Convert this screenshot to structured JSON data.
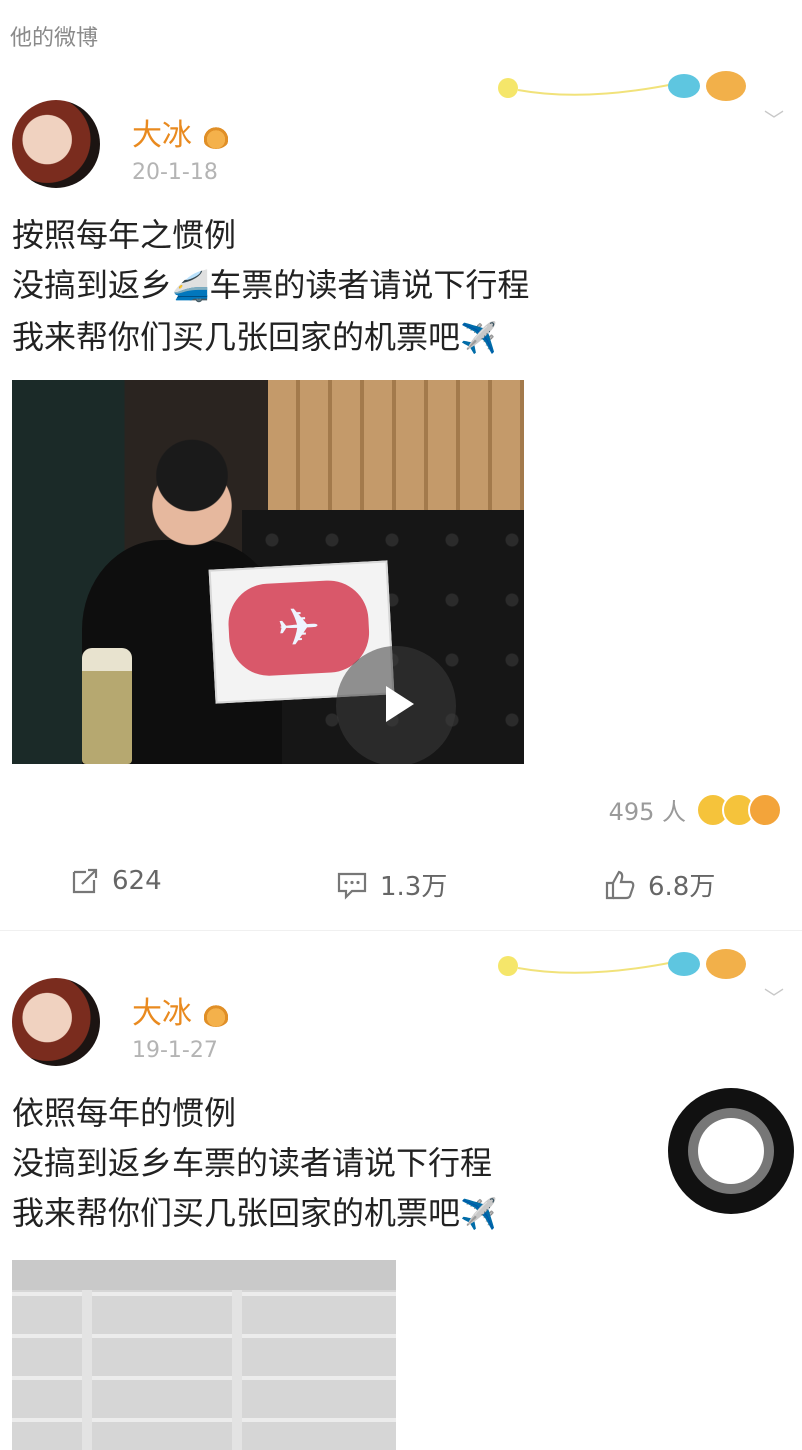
{
  "section_label": "他的微博",
  "posts": [
    {
      "author": "大冰",
      "date": "20-1-18",
      "lines": [
        "按照每年之惯例",
        "没搞到返乡",
        "车票的读者请说下行程",
        "我来帮你们买几张回家的机票吧"
      ],
      "reactions_count": "495 人",
      "repost_count": "624",
      "comment_count": "1.3万",
      "like_count": "6.8万"
    },
    {
      "author": "大冰",
      "date": "19-1-27",
      "lines": [
        "依照每年的惯例",
        "没搞到返乡车票的读者请说下行程",
        "我来帮你们买几张回家的机票吧"
      ]
    }
  ],
  "icons": {
    "train_emoji": "🚄",
    "plane_emoji": "✈️",
    "sign_plane": "✈"
  },
  "colors": {
    "author_name": "#e98a1f",
    "date": "#b4b4b4",
    "muted": "#8a8a8a"
  }
}
